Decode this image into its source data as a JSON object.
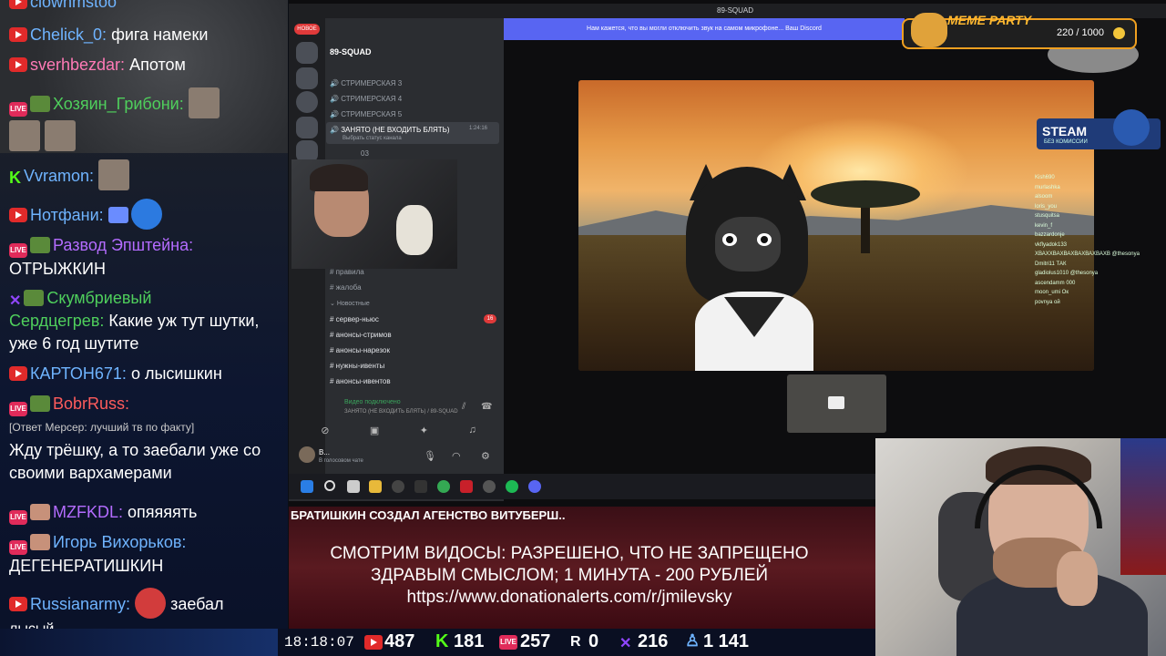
{
  "chat": {
    "messages": [
      {
        "name": "clownmstoo",
        "text": ""
      },
      {
        "name": "Chelick_0:",
        "text": "фига намеки"
      },
      {
        "name": "sverhbezdar:",
        "text": "Апотом"
      },
      {
        "name": "Хозяин_Грибони:",
        "text": ""
      },
      {
        "name": "Vvramon:",
        "text": ""
      },
      {
        "name": "Нотфани:",
        "text": ""
      },
      {
        "name": "Развод Эпштейна:",
        "text": "ОТРЫЖКИН"
      },
      {
        "name": "Скумбриевый",
        "text": ""
      },
      {
        "name": "Сердцегрев:",
        "text": "Какие уж тут шутки, уже 6 год шутите"
      },
      {
        "name": "КАРТОН671:",
        "text": "о лысишкин"
      },
      {
        "name": "BobrRuss:",
        "text": ""
      },
      {
        "reply": "[Ответ Мерсер: лучший тв по факту]"
      },
      {
        "text": "Жду трёшку, а то заебали уже со своими вархамерами"
      },
      {
        "name": "MZFKDL:",
        "text": "опяяяять"
      },
      {
        "name": "Игорь Вихорьков:",
        "text": "ДЕГЕНЕРАТИШКИН"
      },
      {
        "name": "Russianarmy:",
        "text": "заебал"
      },
      {
        "text": "лысый"
      }
    ]
  },
  "discord": {
    "window_title": "89-SQUAD",
    "notice": "Нам кажется, что вы могли отключить звук на самом микрофоне... Ваш Discord",
    "server_name": "89-SQUAD",
    "new_badge": "НОВОЕ",
    "channels": [
      "СТРИМЕРСКАЯ 3",
      "СТРИМЕРСКАЯ 4",
      "СТРИМЕРСКАЯ 5",
      "ЗАНЯТО (НЕ ВХОДИТЬ БЛЯТЬ)"
    ],
    "busy_time": "1:24:16",
    "status_hint": "Выбрать статус канала",
    "user_03": "03",
    "text_channels": [
      "правила",
      "жалоба"
    ],
    "category": "Новостные",
    "news_channels": [
      "сервер-ньюс",
      "анонсы-стримов",
      "анонсы-нарезок",
      "нужны-ивенты",
      "анонсы-ивентов"
    ],
    "news_badge": "16",
    "voice_connected": "Видео подключено",
    "voice_channel": "ЗАНЯТО (НЕ ВХОДИТЬ БЛЯТЬ) / 89-SQUAD",
    "user_name": "B...",
    "user_status": "В голосовом чате"
  },
  "overlay_chat": [
    "Kish690",
    "murlashka",
    "alsoom",
    "loris_you",
    "stusquitsa",
    "kevin_f",
    "bazzardonje",
    "vkflyadok133",
    "ХВАХХВАХВАХВАХВАХВАХВ @thesonya",
    "Dmitri11 ТАК",
    "gladiolus1010 @thesonya",
    "ascendamm 000",
    "moon_umi Ок",
    "povnya ой"
  ],
  "meme_party": {
    "title": "MEME PARTY",
    "score": "220 / 1000"
  },
  "steam": {
    "title": "STEAM",
    "subtitle": "БЕЗ КОМИССИИ"
  },
  "ticker": "БРАТИШКИН СОЗДАЛ АГЕНСТВО ВИТУБЕРШ..",
  "promo": {
    "line1": "СМОТРИМ ВИДОСЫ: РАЗРЕШЕНО, ЧТО НЕ ЗАПРЕЩЕНО",
    "line2": "ЗДРАВЫМ СМЫСЛОМ; 1 МИНУТА - 200 РУБЛЕЙ",
    "line3": "https://www.donationalerts.com/r/jmilevsky"
  },
  "stats": {
    "clock": "18:18:07",
    "youtube": "487",
    "kick": "181",
    "vk": "257",
    "rutube": "0",
    "twitch": "216",
    "total": "1 141"
  },
  "colors": {
    "youtube": "#e12a2a",
    "kick": "#53fc18",
    "vk": "#e02b5a",
    "twitch": "#9146ff",
    "discord": "#5865f2",
    "meme_border": "#f0a020"
  }
}
